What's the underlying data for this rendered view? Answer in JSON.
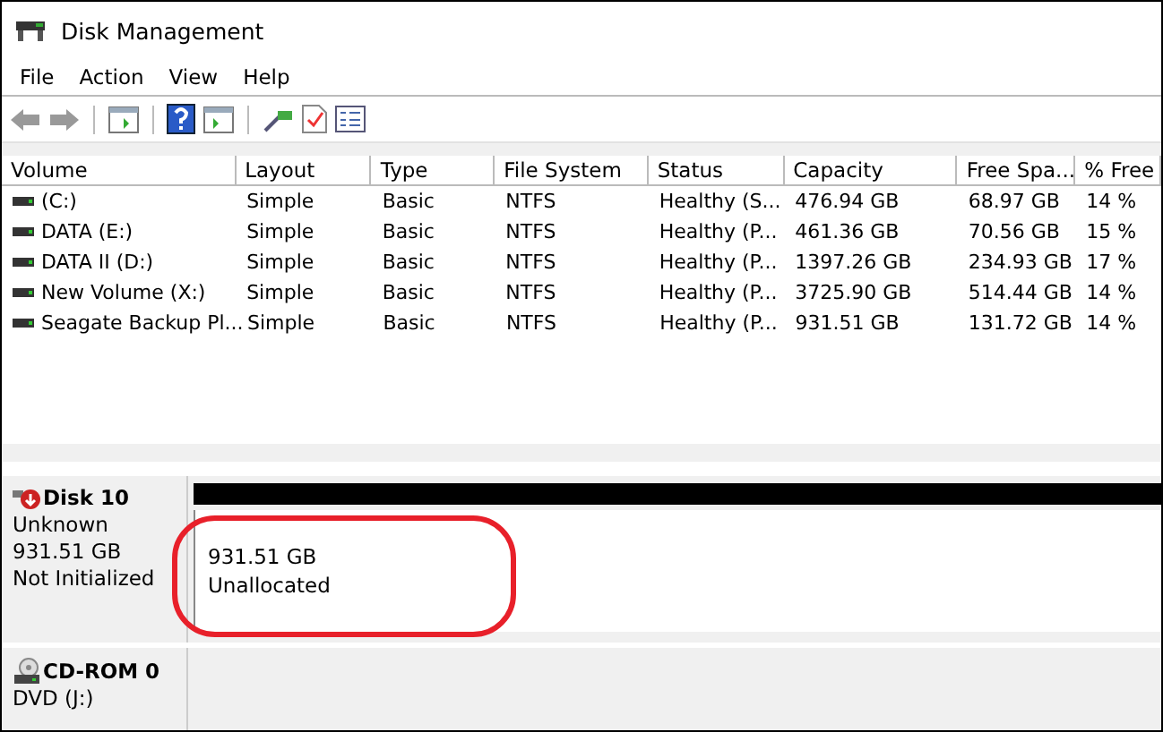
{
  "window": {
    "title": "Disk Management"
  },
  "menu": [
    "File",
    "Action",
    "View",
    "Help"
  ],
  "table": {
    "columns": [
      "Volume",
      "Layout",
      "Type",
      "File System",
      "Status",
      "Capacity",
      "Free Spa...",
      "% Free"
    ],
    "rows": [
      [
        "(C:)",
        "Simple",
        "Basic",
        "NTFS",
        "Healthy (S...",
        "476.94 GB",
        "68.97 GB",
        "14 %"
      ],
      [
        "DATA (E:)",
        "Simple",
        "Basic",
        "NTFS",
        "Healthy (P...",
        "461.36 GB",
        "70.56 GB",
        "15 %"
      ],
      [
        "DATA II (D:)",
        "Simple",
        "Basic",
        "NTFS",
        "Healthy (P...",
        "1397.26 GB",
        "234.93 GB",
        "17 %"
      ],
      [
        "New Volume (X:)",
        "Simple",
        "Basic",
        "NTFS",
        "Healthy (P...",
        "3725.90 GB",
        "514.44 GB",
        "14 %"
      ],
      [
        "Seagate Backup Pl...",
        "Simple",
        "Basic",
        "NTFS",
        "Healthy (P...",
        "931.51 GB",
        "131.72 GB",
        "14 %"
      ]
    ]
  },
  "disks": [
    {
      "kind": "disk",
      "name": "Disk 10",
      "lines": [
        "Unknown",
        "931.51 GB",
        "Not Initialized"
      ],
      "partition": {
        "size": "931.51 GB",
        "status": "Unallocated"
      },
      "highlighted": true
    },
    {
      "kind": "cdrom",
      "name": "CD-ROM 0",
      "lines": [
        "DVD (J:)"
      ]
    }
  ]
}
